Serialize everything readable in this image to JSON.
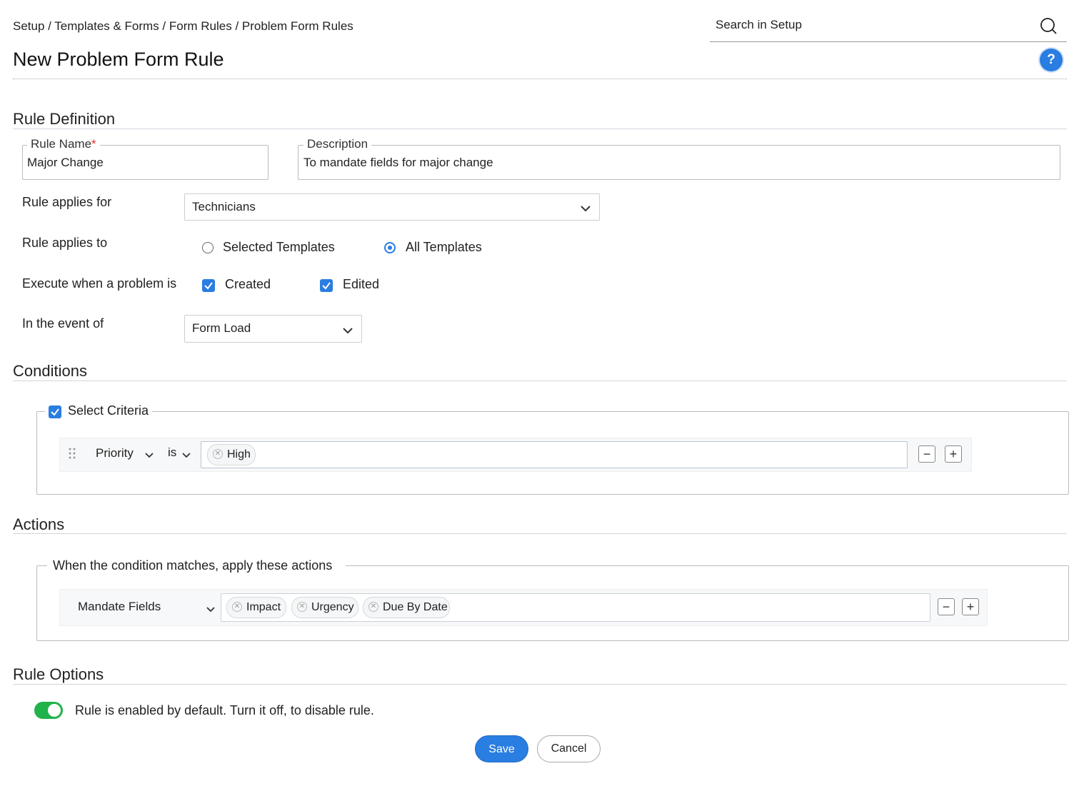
{
  "header": {
    "breadcrumb": "Setup / Templates & Forms / Form Rules / Problem Form Rules",
    "search_placeholder": "Search in Setup",
    "title": "New Problem Form Rule",
    "help_label": "?"
  },
  "rule_definition": {
    "section_title": "Rule Definition",
    "rule_name_label": "Rule Name",
    "required_mark": "*",
    "rule_name_value": "Major Change",
    "description_label": "Description",
    "description_value": "To mandate fields for major change",
    "applies_for_label": "Rule applies for",
    "applies_for_value": "Technicians",
    "applies_to_label": "Rule applies to",
    "applies_to_options": [
      "Selected Templates",
      "All Templates"
    ],
    "applies_to_selected": "All Templates",
    "execute_label": "Execute when a problem is",
    "execute_options": [
      {
        "label": "Created",
        "checked": true
      },
      {
        "label": "Edited",
        "checked": true
      }
    ],
    "event_label": "In the event of",
    "event_value": "Form Load"
  },
  "conditions": {
    "section_title": "Conditions",
    "criteria_label": "Select Criteria",
    "criteria_checked": true,
    "row": {
      "field": "Priority",
      "operator": "is",
      "values": [
        "High"
      ]
    }
  },
  "actions": {
    "section_title": "Actions",
    "legend": "When the condition matches, apply these actions",
    "row": {
      "action": "Mandate Fields",
      "fields": [
        "Impact",
        "Urgency",
        "Due By Date"
      ]
    }
  },
  "rule_options": {
    "section_title": "Rule Options",
    "toggle_enabled": true,
    "toggle_text": "Rule is enabled by default. Turn it off, to disable rule."
  },
  "buttons": {
    "save": "Save",
    "cancel": "Cancel"
  },
  "colors": {
    "accent": "#2a7de1",
    "toggle_on": "#21b24b",
    "required": "#d9342b"
  }
}
